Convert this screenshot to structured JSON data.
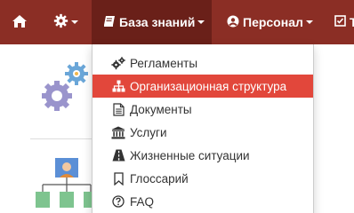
{
  "navbar": {
    "knowledge_base_label": "База знаний",
    "staff_label": "Персонал",
    "more_label": "Т"
  },
  "dropdown": {
    "items": [
      {
        "label": "Регламенты",
        "icon": "gears-icon"
      },
      {
        "label": "Организационная структура",
        "icon": "sitemap-icon",
        "active": true
      },
      {
        "label": "Документы",
        "icon": "document-icon"
      },
      {
        "label": "Услуги",
        "icon": "institution-icon"
      },
      {
        "label": "Жизненные ситуации",
        "icon": "road-icon"
      },
      {
        "label": "Глоссарий",
        "icon": "bookmark-icon"
      },
      {
        "label": "FAQ",
        "icon": "question-circle-icon"
      }
    ]
  },
  "colors": {
    "navbar": "#8b2e25",
    "navbar_active": "#6a2019",
    "menu_active": "#e2473b"
  }
}
